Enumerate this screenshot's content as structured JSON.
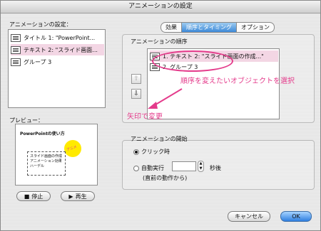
{
  "window": {
    "title": "アニメーションの設定"
  },
  "left": {
    "section_label": "アニメーションの設定：",
    "items": [
      {
        "label": "タイトル 1: \"PowerPoint..."
      },
      {
        "label": "テキスト 2: \"スライド画面..."
      },
      {
        "label": "グループ 3"
      }
    ],
    "preview_label": "プレビュー：",
    "preview": {
      "slide_title": "PowerPointの使い方",
      "bullets": [
        "スライド画面の作成",
        "アニメーション効果",
        "ハーデル"
      ],
      "badge": "アニメ"
    },
    "stop_button": "停止",
    "play_button": "再生"
  },
  "tabs": [
    "効果",
    "順序とタイミング",
    "オプション"
  ],
  "active_tab": "順序とタイミング",
  "order": {
    "label": "アニメーションの順序",
    "items": [
      "1. テキスト 2: \"スライド画面の作成...\"",
      "2. グループ 3"
    ]
  },
  "annotations": {
    "select_hint": "順序を変えたいオブジェクトを選択",
    "arrow_hint": "矢印で変更"
  },
  "start": {
    "label": "アニメーションの開始",
    "on_click": "クリック時",
    "auto": "自動実行",
    "seconds_suffix": "秒後",
    "after_prev": "(直前の動作から)",
    "seconds_value": ""
  },
  "footer": {
    "cancel": "キャンセル",
    "ok": "OK"
  },
  "colors": {
    "accent": "#2f7fe0",
    "annotation": "#e43b8b",
    "selection": "#f3d6e4"
  }
}
